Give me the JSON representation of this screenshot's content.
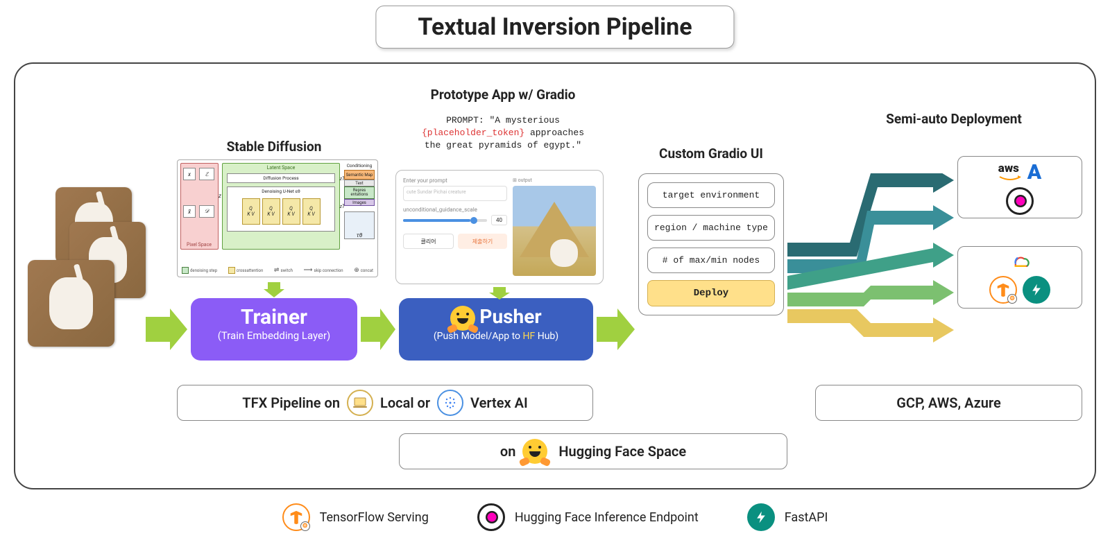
{
  "title": "Textual Inversion Pipeline",
  "sections": {
    "stable_diffusion": "Stable Diffusion",
    "prototype": "Prototype App w/ Gradio",
    "custom_ui": "Custom Gradio UI",
    "semi_auto": "Semi-auto Deployment"
  },
  "sd_panel": {
    "latent_space": "Latent Space",
    "diffusion_process": "Diffusion Process",
    "denoising_unet": "Denoising U-Net εθ",
    "pixel_space": "Pixel Space",
    "conditioning": "Conditioning",
    "semantic_map": "Semantic Map",
    "text": "Text",
    "repres": "Repres entations",
    "images": "Images",
    "q": "Q",
    "kv": "K V",
    "tau_theta": "τθ",
    "zt": "zT",
    "z": "z",
    "x": "x",
    "x_tilde": "x̃",
    "enc": "ℰ",
    "dec": "𝒟",
    "leg_denoise": "denoising step",
    "leg_cross": "crossattention",
    "leg_switch": "switch",
    "leg_skip": "skip connection",
    "leg_concat": "concat"
  },
  "prompt": {
    "line1": "PROMPT: \"A mysterious",
    "token": "{placeholder_token}",
    "line2_suffix": " approaches",
    "line3": "the great pyramids of egypt.\""
  },
  "trainer": {
    "title": "Trainer",
    "sub": "(Train Embedding Layer)"
  },
  "pusher": {
    "title": "Pusher",
    "sub_pre": "(Push Model/App to ",
    "sub_hf": "HF",
    "sub_post": " Hub)"
  },
  "gradio_mock": {
    "enter_prompt_label": "Enter your prompt",
    "input_placeholder": "cute Sundar Pichai creature",
    "guidance_label": "unconditional_guidance_scale",
    "guidance_value": "40",
    "clear_btn": "클리어",
    "submit_btn": "제출하기",
    "output_label": "⊞ output"
  },
  "deploy_ui": {
    "field1": "target environment",
    "field2": "region / machine type",
    "field3": "# of max/min nodes",
    "deploy": "Deploy"
  },
  "pills": {
    "tfx_pre": "TFX Pipeline on ",
    "tfx_local": "Local or",
    "tfx_vertex": "Vertex AI",
    "hf_space_pre": "on ",
    "hf_space": "Hugging Face Space",
    "clouds": "GCP, AWS, Azure"
  },
  "legend": {
    "tf_serving": "TensorFlow Serving",
    "hf_infer": "Hugging Face Inference Endpoint",
    "fastapi": "FastAPI"
  },
  "cloud_icons": {
    "aws": "aws",
    "azure": "A"
  },
  "colors": {
    "arrow_green": "#a0d040",
    "fan_arrows": [
      "#2a6b72",
      "#3a8f99",
      "#3fa088",
      "#7cc070",
      "#e8c860"
    ]
  }
}
